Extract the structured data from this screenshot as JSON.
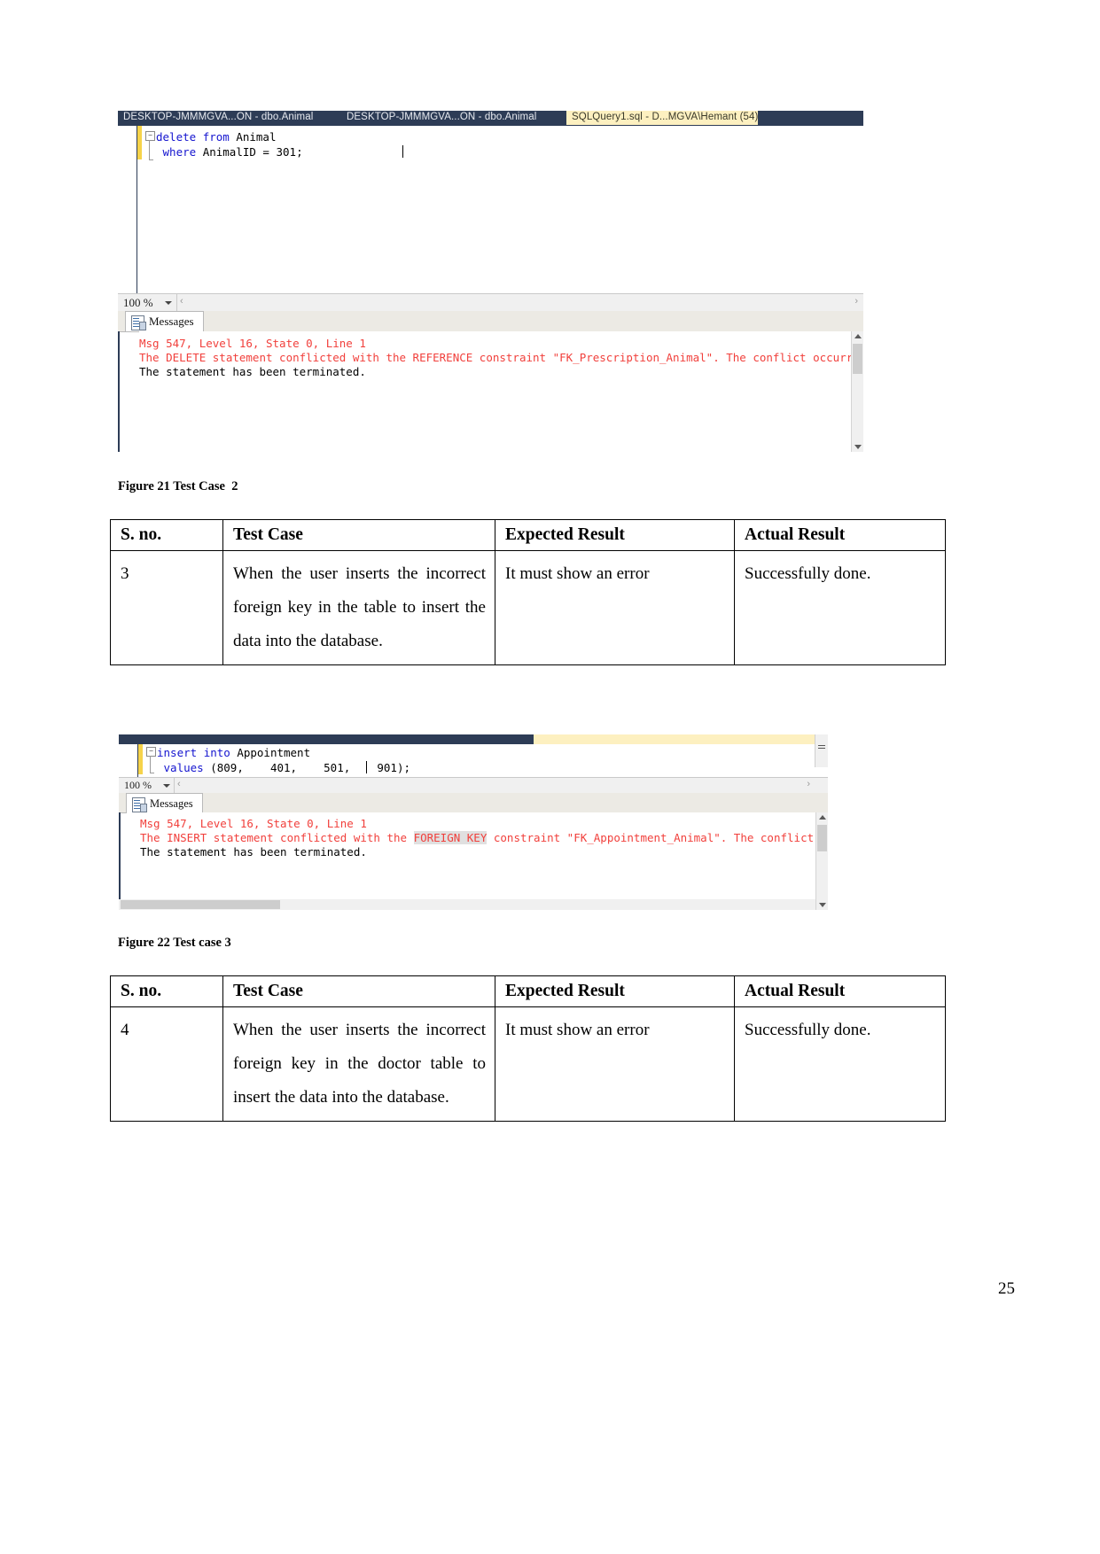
{
  "page": {
    "number": "25"
  },
  "figure21": {
    "caption": "Figure 21 Test Case  2",
    "ssms": {
      "tabs": [
        {
          "label": "DESKTOP-JMMMGVA...ON - dbo.Animal",
          "active": false
        },
        {
          "label": "DESKTOP-JMMMGVA...ON - dbo.Animal",
          "active": false
        },
        {
          "label": "SQLQuery1.sql - D...MGVA\\Hemant (54))",
          "active": true,
          "close": "×"
        }
      ],
      "code": {
        "line1_kw1": "delete",
        "line1_kw2": "from",
        "line1_rest": "Animal",
        "line2_kw": "where",
        "line2_rest": "AnimalID = 301",
        "line2_tail": ";"
      },
      "zoom_value": "100 %",
      "messages_tab": "Messages",
      "messages": [
        "Msg 547, Level 16, State 0, Line 1",
        "The DELETE statement conflicted with the REFERENCE constraint \"FK_Prescription_Animal\". The conflict occurred in",
        "The statement has been terminated."
      ]
    }
  },
  "table21": {
    "headers": [
      "S. no.",
      "Test Case",
      "Expected Result",
      "Actual Result"
    ],
    "rows": [
      {
        "sno": "3",
        "test_case": "When the user inserts the incorrect foreign key in the table to insert the data into the database.",
        "expected": "It must show an error",
        "actual": "Successfully done."
      }
    ]
  },
  "figure22": {
    "caption": "Figure 22 Test case 3",
    "ssms": {
      "code": {
        "line1_kw1": "insert",
        "line1_kw2": "into",
        "line1_rest": "Appointment",
        "line2_kw": "values",
        "line2_rest": "(809,    401,    501,    901",
        "line2_tail": ");"
      },
      "zoom_value": "100 %",
      "messages_tab": "Messages",
      "messages": [
        "Msg 547, Level 16, State 0, Line 1",
        "The INSERT statement conflicted with the ",
        "FOREIGN KEY",
        " constraint \"FK_Appointment_Animal\". The conflict occurred in",
        "The statement has been terminated."
      ]
    }
  },
  "table22": {
    "headers": [
      "S. no.",
      "Test Case",
      "Expected Result",
      "Actual Result"
    ],
    "rows": [
      {
        "sno": "4",
        "test_case": "When the user inserts the incorrect foreign key in the doctor table to insert the data into the database.",
        "expected": "It must show an error",
        "actual": "Successfully done."
      }
    ]
  }
}
